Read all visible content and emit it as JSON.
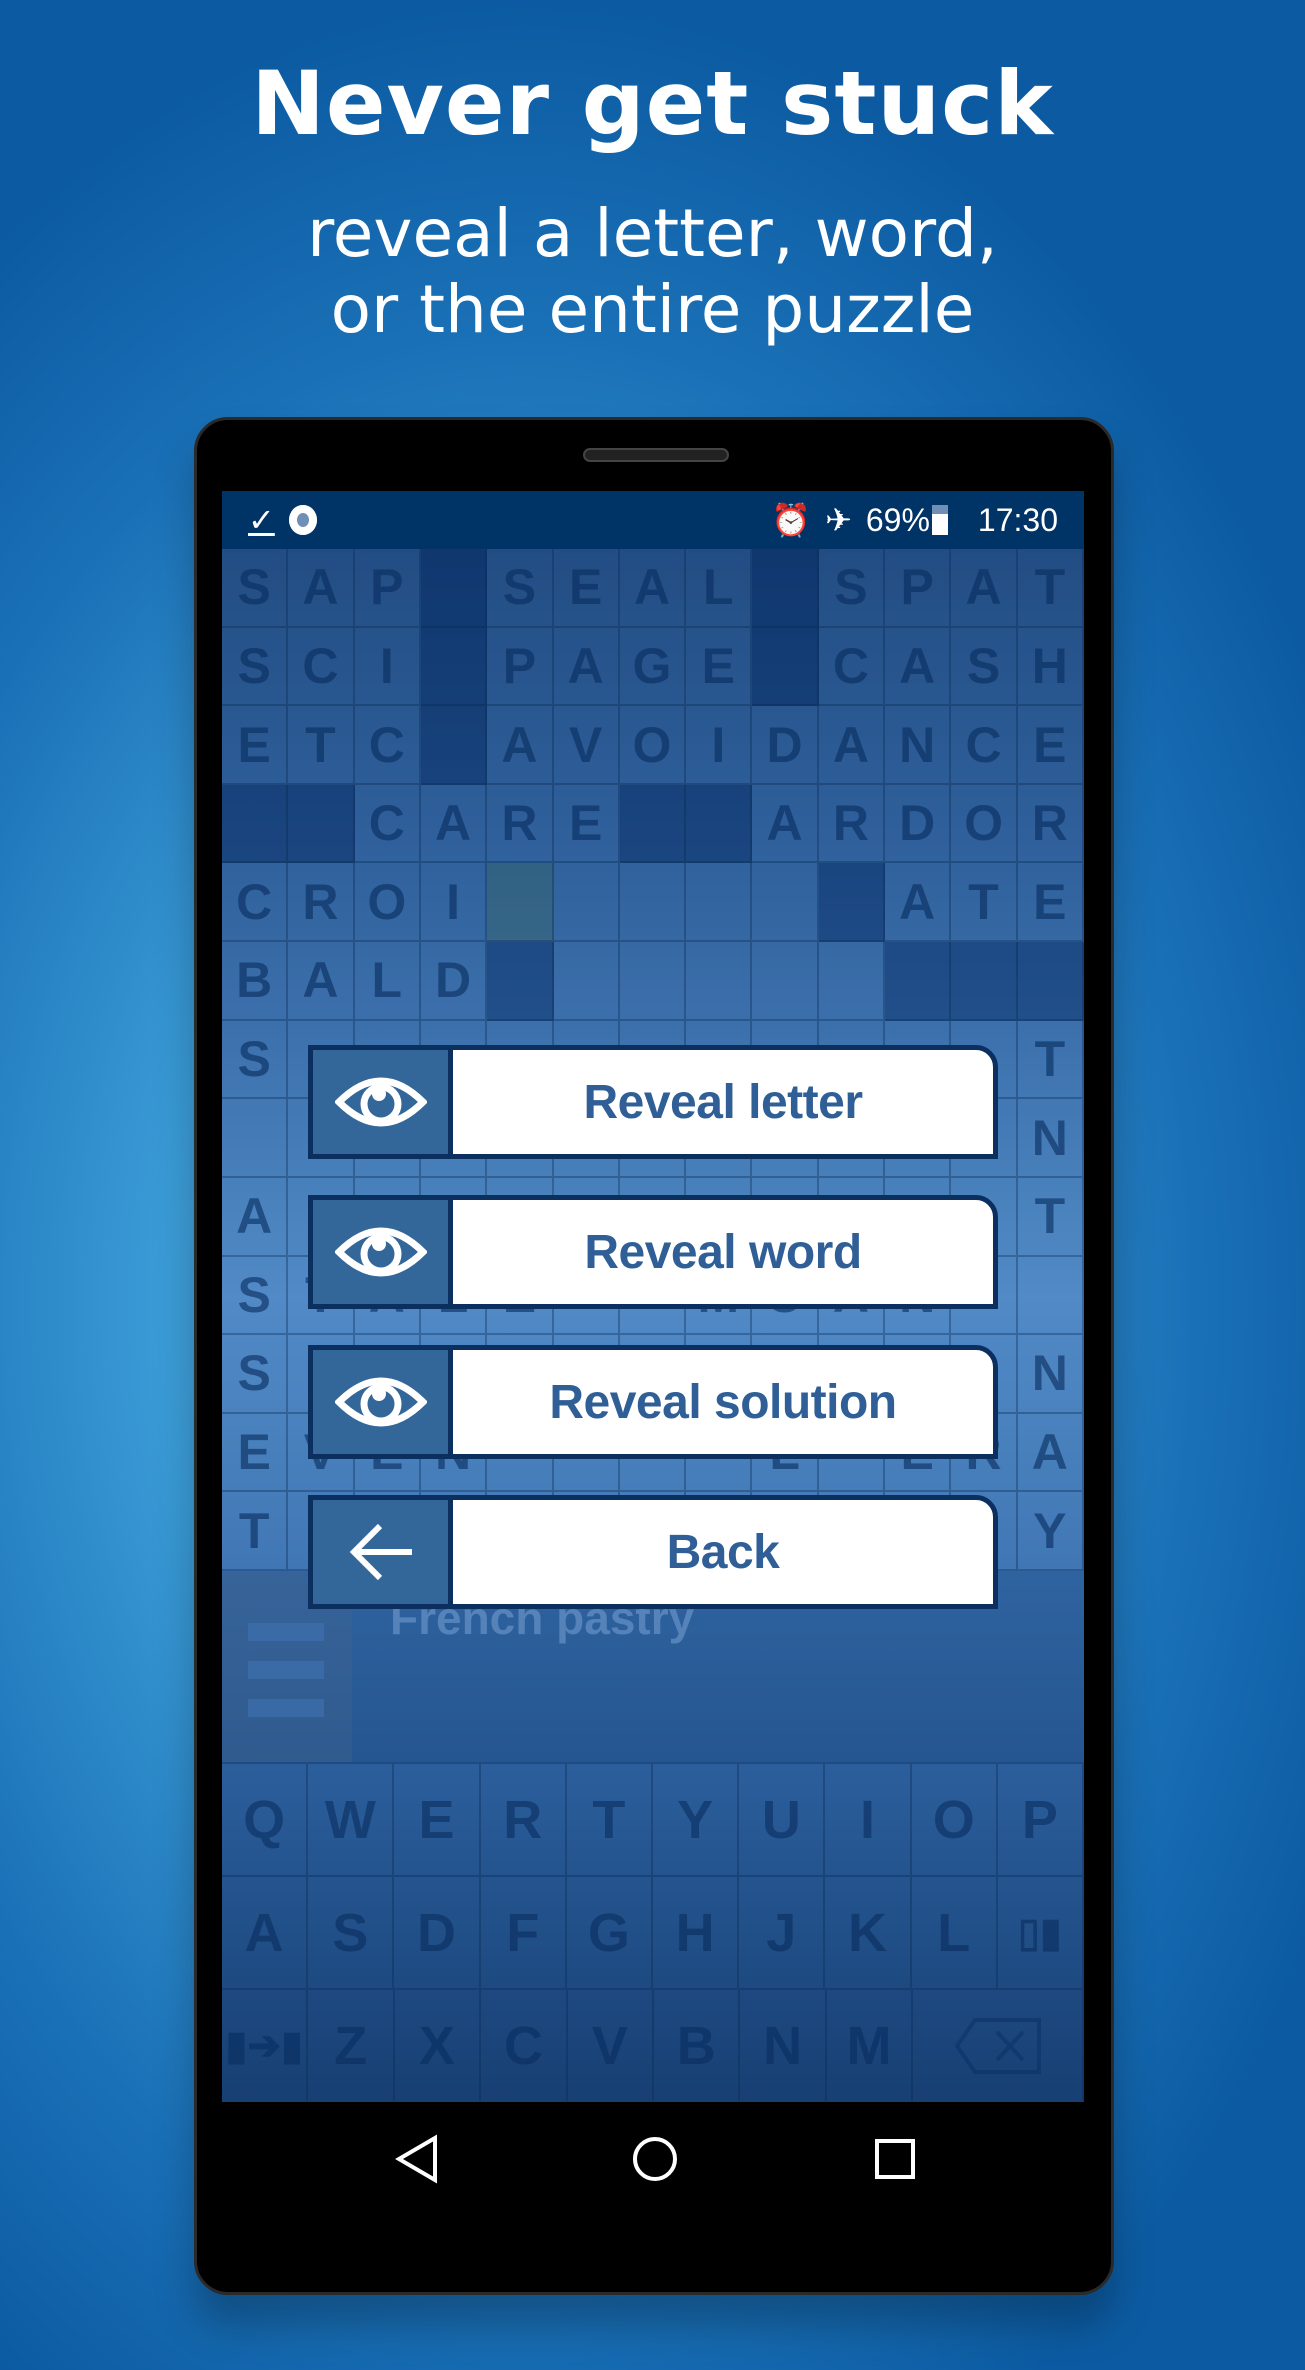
{
  "header": {
    "title": "Never get stuck",
    "subtitle_line1": "reveal a letter, word,",
    "subtitle_line2": "or the entire puzzle"
  },
  "status_bar": {
    "left_icons": [
      "checkmark-download-icon",
      "record-icon"
    ],
    "right_icons": [
      "alarm-icon",
      "airplane-icon",
      "battery-charging-icon"
    ],
    "battery": "69%",
    "time": "17:30"
  },
  "grid": {
    "rows": [
      [
        "S",
        "A",
        "P",
        "#",
        "S",
        "E",
        "A",
        "L",
        "#",
        "S",
        "P",
        "A",
        "T"
      ],
      [
        "S",
        "C",
        "I",
        "#",
        "P",
        "A",
        "G",
        "E",
        "#",
        "C",
        "A",
        "S",
        "H"
      ],
      [
        "E",
        "T",
        "C",
        "#",
        "A",
        "V",
        "O",
        "I",
        "D",
        "A",
        "N",
        "C",
        "E"
      ],
      [
        "#",
        "#",
        "C",
        "A",
        "R",
        "E",
        "#",
        "#",
        "A",
        "R",
        "D",
        "O",
        "R"
      ],
      [
        "C",
        "R",
        "O",
        "I",
        "*",
        "",
        "",
        "",
        "",
        "#",
        "A",
        "T",
        "E"
      ],
      [
        "B",
        "A",
        "L",
        "D",
        "#",
        "",
        "",
        "",
        "",
        "",
        "#",
        "#",
        "#"
      ],
      [
        "S",
        "",
        "",
        "",
        "",
        "",
        "",
        "",
        "",
        "",
        "",
        "",
        "T"
      ],
      [
        "",
        "",
        "",
        "",
        "",
        "",
        "",
        "",
        "",
        "",
        "",
        "",
        "N"
      ],
      [
        "A",
        "",
        "",
        "",
        "",
        "",
        "",
        "",
        "",
        "",
        "",
        "",
        "T"
      ],
      [
        "S",
        "T",
        "A",
        "L",
        "E",
        "",
        "",
        "M",
        "O",
        "A",
        "N",
        "",
        ""
      ],
      [
        "S",
        "",
        "",
        "",
        "",
        "",
        "",
        "",
        "",
        "",
        "",
        "",
        "N"
      ],
      [
        "E",
        "V",
        "E",
        "N",
        "",
        "",
        "",
        "",
        "L",
        "",
        "E",
        "R",
        "A"
      ],
      [
        "T",
        "",
        "",
        "",
        "",
        "",
        "",
        "",
        "",
        "",
        "",
        "",
        "Y"
      ]
    ]
  },
  "clue": {
    "text": "French pastry"
  },
  "keyboard": {
    "rows": [
      [
        "Q",
        "W",
        "E",
        "R",
        "T",
        "Y",
        "U",
        "I",
        "O",
        "P"
      ],
      [
        "A",
        "S",
        "D",
        "F",
        "G",
        "H",
        "J",
        "K",
        "L"
      ],
      [
        "Z",
        "X",
        "C",
        "V",
        "B",
        "N",
        "M"
      ]
    ]
  },
  "dialog": {
    "buttons": [
      {
        "label": "Reveal letter",
        "icon": "eye-icon"
      },
      {
        "label": "Reveal word",
        "icon": "eye-icon"
      },
      {
        "label": "Reveal solution",
        "icon": "eye-icon"
      },
      {
        "label": "Back",
        "icon": "arrow-left-icon"
      }
    ]
  },
  "colors": {
    "accent": "#336699",
    "button_text": "#2f5f96",
    "border": "#0b2f5e",
    "status_bar": "#003366"
  }
}
